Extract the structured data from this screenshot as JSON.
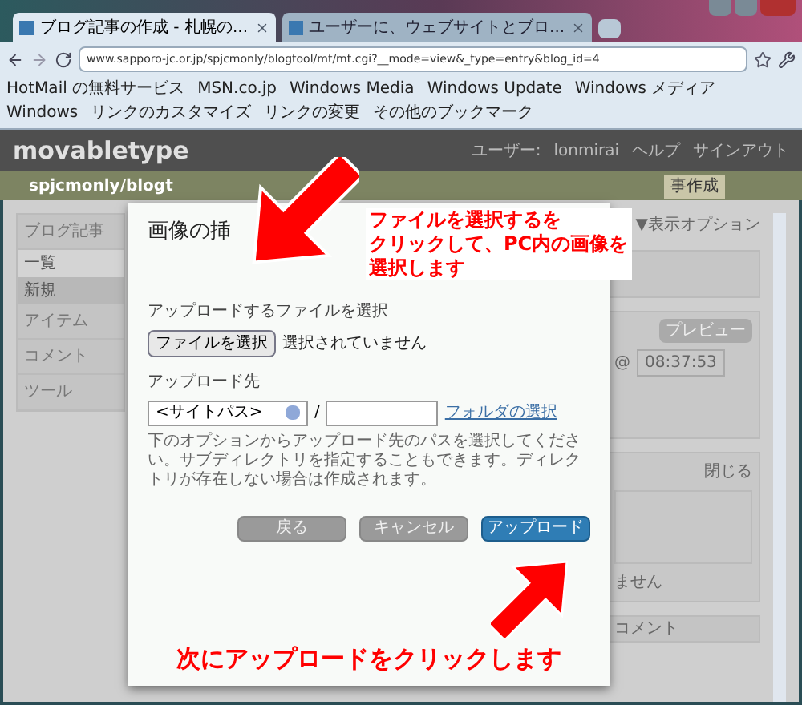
{
  "browser": {
    "tabs": [
      {
        "label": "ブログ記事の作成 - 札幌の...",
        "selected": true
      },
      {
        "label": "ユーザーに、ウェブサイトとブロ...",
        "selected": false
      }
    ],
    "address": {
      "url": "www.sapporo-jc.or.jp/spjcmonly/blogtool/mt/mt.cgi?__mode=view&_type=entry&blog_id=4"
    },
    "bookmarks": [
      {
        "label": "HotMail の無料サービス"
      },
      {
        "label": "MSN.co.jp"
      },
      {
        "label": "Windows Media"
      },
      {
        "label": "Windows Update"
      },
      {
        "label": "Windows メディア"
      },
      {
        "label": "Windows"
      },
      {
        "label": "リンクのカスタマイズ"
      },
      {
        "label": "リンクの変更"
      },
      {
        "label": "その他のブックマーク"
      }
    ]
  },
  "mt_header": {
    "logo": "movabletype",
    "user_label": "ユーザー:",
    "user_name": "lonmirai",
    "links": [
      "ヘルプ",
      "サインアウト"
    ]
  },
  "blog_bar": {
    "name": "spjcmonly/blogt",
    "new_button": "事作成"
  },
  "sidebar": {
    "sections": [
      {
        "label": "ブログ記事",
        "children": [
          {
            "label": "一覧",
            "selected": false
          },
          {
            "label": "新規",
            "selected": true
          }
        ]
      },
      {
        "label": "アイテム"
      },
      {
        "label": "コメント"
      },
      {
        "label": "ツール"
      }
    ]
  },
  "right_panel": {
    "display_options": "▼表示オプション",
    "preview_button": "プレビュー",
    "at_sign": "@",
    "time_value": "08:37:53",
    "close_link": "閉じる",
    "text_fragment": "ません",
    "comment_heading": "コメント"
  },
  "dialog": {
    "title": "画像の挿",
    "file_label": "アップロードするファイルを選択",
    "file_button": "ファイルを選択",
    "file_status": "選択されていません",
    "dest_label": "アップロード先",
    "dest_select": "<サイトパス>",
    "slash": "/",
    "folder_link": "フォルダの選択",
    "help_text": "下のオプションからアップロード先のパスを選択してください。サブディレクトリを指定することもできます。ディレクトリが存在しない場合は作成されます。",
    "buttons": [
      {
        "label": "戻る",
        "kind": "secondary"
      },
      {
        "label": "キャンセル",
        "kind": "secondary"
      },
      {
        "label": "アップロード",
        "kind": "primary"
      }
    ]
  },
  "annotations": [
    {
      "kind": "top",
      "lines": [
        "ファイルを選択するを",
        "クリックして、PC内の画像を",
        "選択します"
      ]
    },
    {
      "kind": "bottom",
      "lines": [
        "次にアップロードをクリックします"
      ]
    }
  ]
}
